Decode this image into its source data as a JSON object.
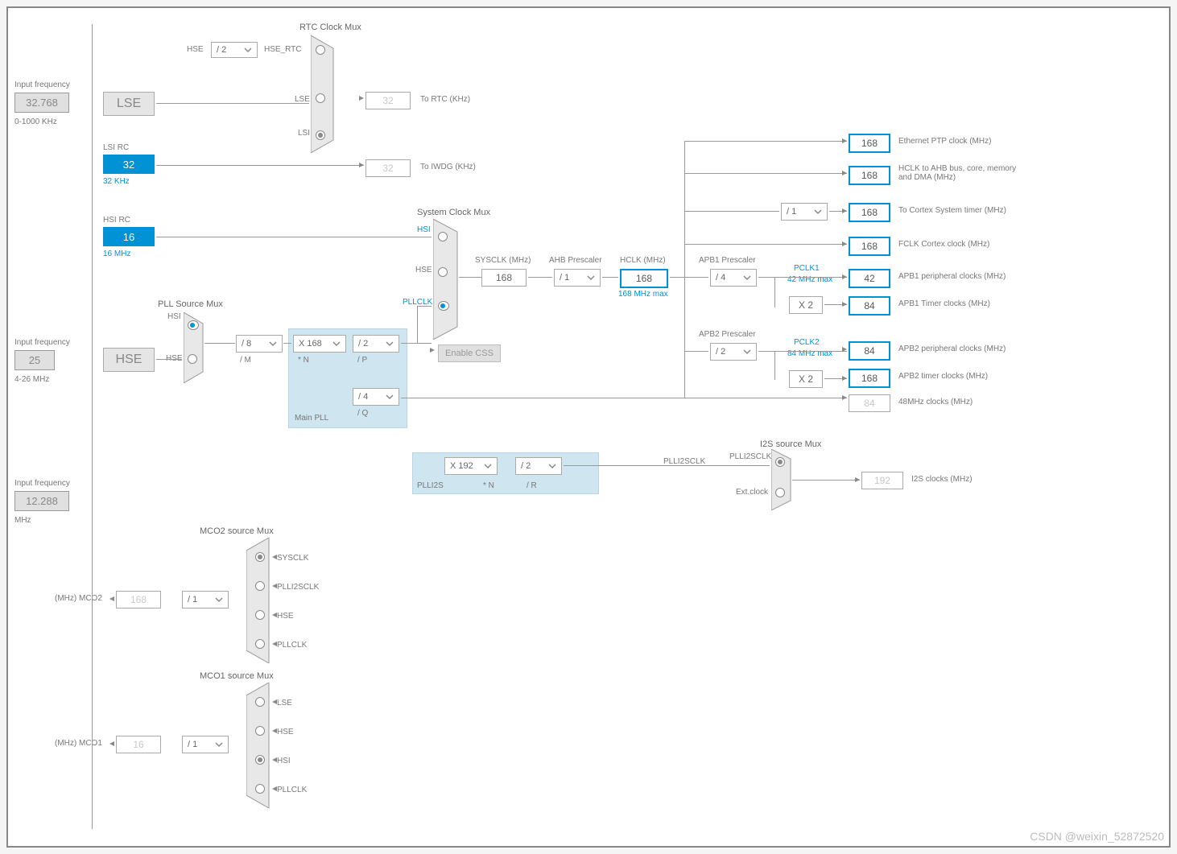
{
  "inputs": {
    "lse": {
      "label": "Input frequency",
      "value": "32.768",
      "range": "0-1000 KHz"
    },
    "hse": {
      "label": "Input frequency",
      "value": "25",
      "range": "4-26 MHz"
    },
    "i2s": {
      "label": "Input frequency",
      "value": "12.288",
      "unit": "MHz"
    }
  },
  "sources": {
    "lse": "LSE",
    "lsi": {
      "title": "LSI RC",
      "value": "32",
      "sub": "32 KHz"
    },
    "hsi": {
      "title": "HSI RC",
      "value": "16",
      "sub": "16 MHz"
    },
    "hse": "HSE"
  },
  "rtc": {
    "title": "RTC Clock Mux",
    "hse_div": "/ 2",
    "hse_rtc": "HSE_RTC",
    "out": "32",
    "out_label": "To RTC (KHz)",
    "inputs": [
      "HSE",
      "LSE",
      "LSI"
    ]
  },
  "iwdg": {
    "out": "32",
    "label": "To IWDG (KHz)"
  },
  "pllsrc": {
    "title": "PLL Source Mux",
    "inputs": [
      "HSI",
      "HSE"
    ]
  },
  "pll": {
    "title": "Main PLL",
    "m": "/ 8",
    "m_lbl": "/ M",
    "n": "X 168",
    "n_lbl": "* N",
    "p": "/ 2",
    "p_lbl": "/ P",
    "q": "/ 4",
    "q_lbl": "/ Q"
  },
  "plli2s": {
    "title": "PLLI2S",
    "n": "X 192",
    "n_lbl": "* N",
    "r": "/ 2",
    "r_lbl": "/ R"
  },
  "sysmux": {
    "title": "System Clock Mux",
    "inputs": [
      "HSI",
      "HSE",
      "PLLCLK"
    ],
    "enable_css": "Enable CSS"
  },
  "sysclk": {
    "label": "SYSCLK (MHz)",
    "value": "168"
  },
  "ahb": {
    "label": "AHB Prescaler",
    "value": "/ 1"
  },
  "hclk": {
    "label": "HCLK (MHz)",
    "value": "168",
    "max": "168 MHz max"
  },
  "cortex_div": "/ 1",
  "apb1": {
    "label": "APB1 Prescaler",
    "value": "/ 4",
    "pclk": "PCLK1",
    "max": "42 MHz max",
    "mult": "X 2"
  },
  "apb2": {
    "label": "APB2 Prescaler",
    "value": "/ 2",
    "pclk": "PCLK2",
    "max": "84 MHz max",
    "mult": "X 2"
  },
  "outputs": {
    "eth": {
      "value": "168",
      "label": "Ethernet PTP clock (MHz)"
    },
    "hclk": {
      "value": "168",
      "label": "HCLK to AHB bus, core, memory and DMA (MHz)"
    },
    "cortex": {
      "value": "168",
      "label": "To Cortex System timer (MHz)"
    },
    "fclk": {
      "value": "168",
      "label": "FCLK Cortex clock (MHz)"
    },
    "apb1p": {
      "value": "42",
      "label": "APB1 peripheral clocks (MHz)"
    },
    "apb1t": {
      "value": "84",
      "label": "APB1 Timer clocks (MHz)"
    },
    "apb2p": {
      "value": "84",
      "label": "APB2 peripheral clocks (MHz)"
    },
    "apb2t": {
      "value": "168",
      "label": "APB2 timer clocks (MHz)"
    },
    "usb48": {
      "value": "84",
      "label": "48MHz clocks (MHz)"
    },
    "i2s": {
      "value": "192",
      "label": "I2S clocks (MHz)"
    }
  },
  "i2smux": {
    "title": "I2S source Mux",
    "inputs": [
      "PLLI2SCLK",
      "Ext.clock"
    ],
    "sig": "PLLI2SCLK"
  },
  "mco2": {
    "title": "MCO2 source Mux",
    "inputs": [
      "SYSCLK",
      "PLLI2SCLK",
      "HSE",
      "PLLCLK"
    ],
    "div": "/ 1",
    "out": "168",
    "label": "(MHz) MCO2"
  },
  "mco1": {
    "title": "MCO1 source Mux",
    "inputs": [
      "LSE",
      "HSE",
      "HSI",
      "PLLCLK"
    ],
    "div": "/ 1",
    "out": "16",
    "label": "(MHz) MCO1"
  },
  "watermark": "CSDN @weixin_52872520"
}
